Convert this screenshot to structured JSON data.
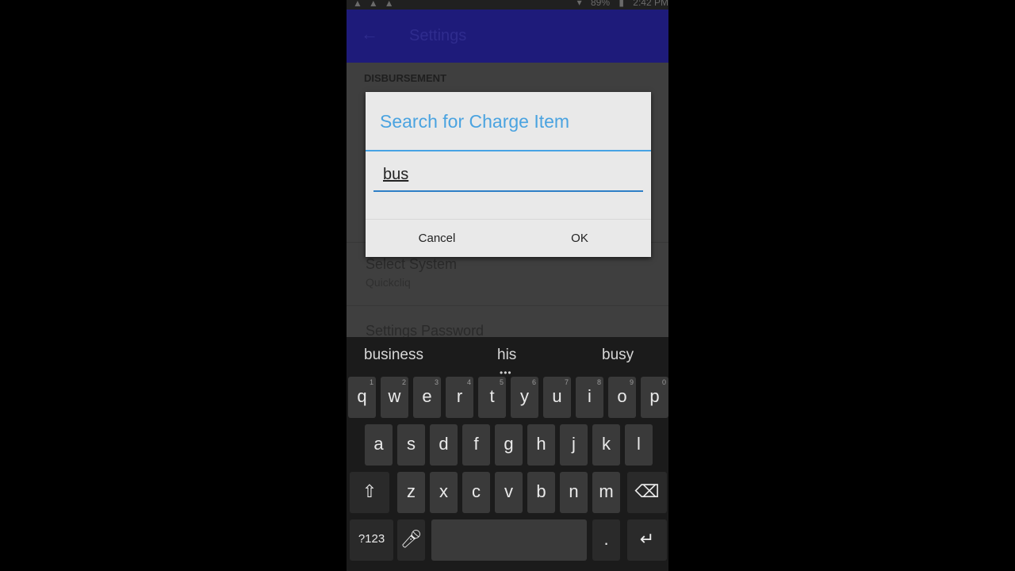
{
  "status_bar": {
    "battery": "89%",
    "time": "2:42 PM"
  },
  "app_bar": {
    "title": "Settings"
  },
  "settings": {
    "section_header": "DISBURSEMENT",
    "prefs": [
      {
        "title": "Select System",
        "summary": "Quickcliq"
      },
      {
        "title": "Settings Password",
        "summary": ""
      }
    ]
  },
  "dialog": {
    "title": "Search for Charge Item",
    "input_value": "bus",
    "cancel_label": "Cancel",
    "ok_label": "OK"
  },
  "keyboard": {
    "suggestions": [
      "business",
      "his",
      "busy"
    ],
    "row1": [
      "q",
      "w",
      "e",
      "r",
      "t",
      "y",
      "u",
      "i",
      "o",
      "p"
    ],
    "row1_nums": [
      "1",
      "2",
      "3",
      "4",
      "5",
      "6",
      "7",
      "8",
      "9",
      "0"
    ],
    "row2": [
      "a",
      "s",
      "d",
      "f",
      "g",
      "h",
      "j",
      "k",
      "l"
    ],
    "row3": [
      "z",
      "x",
      "c",
      "v",
      "b",
      "n",
      "m"
    ],
    "symbols_label": "?123",
    "period_label": "."
  },
  "colors": {
    "accent": "#4aa3e0",
    "app_bar": "#1e1b7a"
  }
}
